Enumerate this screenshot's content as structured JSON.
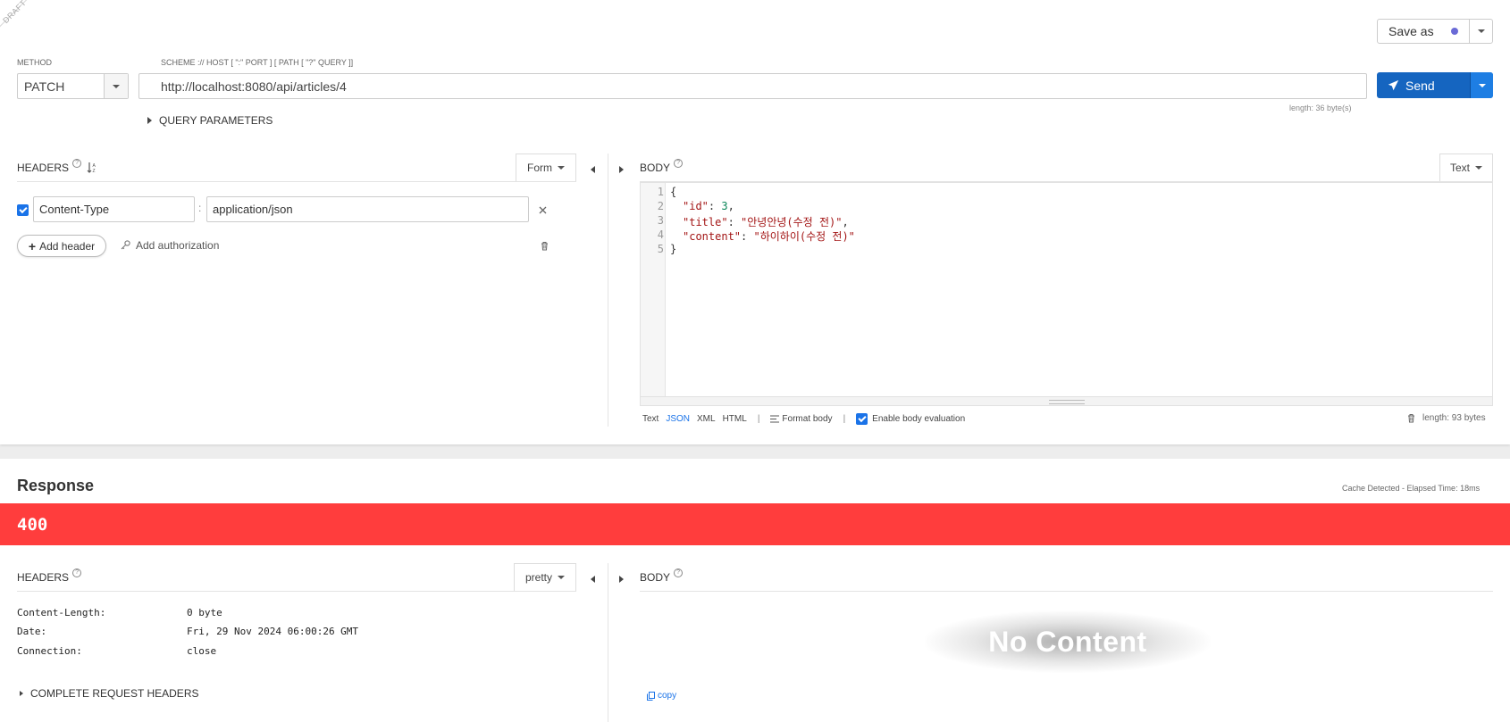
{
  "request": {
    "draft_label": "DRAFT",
    "method_label": "METHOD",
    "method_value": "PATCH",
    "url_label": "SCHEME :// HOST [ \":\" PORT ] [ PATH [ \"?\" QUERY ]]",
    "url_value": "http://localhost:8080/api/articles/4",
    "url_length": "length: 36 byte(s)",
    "save_as_label": "Save as",
    "send_label": "Send",
    "query_params_label": "QUERY PARAMETERS",
    "headers": {
      "title": "HEADERS",
      "mode_label": "Form",
      "items": [
        {
          "enabled": true,
          "name": "Content-Type",
          "value": "application/json"
        }
      ],
      "add_header_label": "Add header",
      "add_authorization_label": "Add authorization"
    },
    "body": {
      "title": "BODY",
      "mode_label": "Text",
      "lines": [
        {
          "n": "1",
          "text": "{"
        },
        {
          "n": "2",
          "key": "\"id\"",
          "sep": ": ",
          "num": "3",
          "end": ","
        },
        {
          "n": "3",
          "key": "\"title\"",
          "sep": ": ",
          "str": "\"안녕안녕(수정 전)\"",
          "end": ","
        },
        {
          "n": "4",
          "key": "\"content\"",
          "sep": ": ",
          "str": "\"하이하이(수정 전)\"",
          "end": ""
        },
        {
          "n": "5",
          "text": "}"
        }
      ],
      "formats": [
        "Text",
        "JSON",
        "XML",
        "HTML"
      ],
      "active_format": "JSON",
      "format_body_label": "Format body",
      "enable_eval_label": "Enable body evaluation",
      "length": "length: 93 bytes"
    }
  },
  "response": {
    "title": "Response",
    "cache_info": "Cache Detected - Elapsed Time: 18ms",
    "status_code": "400",
    "status_color": "#ff3d3d",
    "headers": {
      "title": "HEADERS",
      "mode_label": "pretty",
      "items": [
        {
          "name": "Content-Length:",
          "value": "0 byte"
        },
        {
          "name": "Date:",
          "value": "Fri, 29 Nov 2024 06:00:26 GMT"
        },
        {
          "name": "Connection:",
          "value": "close"
        }
      ],
      "complete_request_label": "COMPLETE REQUEST HEADERS"
    },
    "body": {
      "title": "BODY",
      "empty_text": "No Content",
      "copy_label": "copy"
    }
  },
  "colors": {
    "primary": "#1565c0",
    "accent_link": "#1a73e8",
    "error": "#ff3d3d"
  }
}
